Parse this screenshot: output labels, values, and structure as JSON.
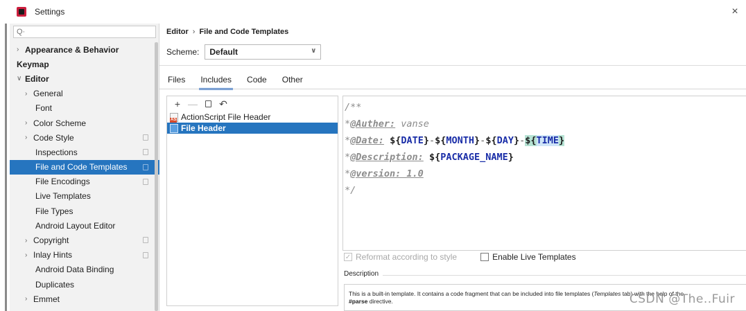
{
  "window": {
    "title": "Settings",
    "close_symbol": "×"
  },
  "search": {
    "placeholder": "Q·"
  },
  "sidebar": {
    "items": [
      {
        "label": "Appearance & Behavior",
        "level": 0,
        "arrow": ">",
        "bold": true,
        "copy": false,
        "selected": false
      },
      {
        "label": "Keymap",
        "level": 0,
        "arrow": "",
        "bold": true,
        "copy": false,
        "selected": false
      },
      {
        "label": "Editor",
        "level": 0,
        "arrow": "v",
        "bold": true,
        "copy": false,
        "selected": false
      },
      {
        "label": "General",
        "level": 1,
        "arrow": ">",
        "bold": false,
        "copy": false,
        "selected": false
      },
      {
        "label": "Font",
        "level": 2,
        "arrow": "",
        "bold": false,
        "copy": false,
        "selected": false
      },
      {
        "label": "Color Scheme",
        "level": 1,
        "arrow": ">",
        "bold": false,
        "copy": false,
        "selected": false
      },
      {
        "label": "Code Style",
        "level": 1,
        "arrow": ">",
        "bold": false,
        "copy": true,
        "selected": false
      },
      {
        "label": "Inspections",
        "level": 2,
        "arrow": "",
        "bold": false,
        "copy": true,
        "selected": false
      },
      {
        "label": "File and Code Templates",
        "level": 2,
        "arrow": "",
        "bold": false,
        "copy": true,
        "selected": true
      },
      {
        "label": "File Encodings",
        "level": 2,
        "arrow": "",
        "bold": false,
        "copy": true,
        "selected": false
      },
      {
        "label": "Live Templates",
        "level": 2,
        "arrow": "",
        "bold": false,
        "copy": false,
        "selected": false
      },
      {
        "label": "File Types",
        "level": 2,
        "arrow": "",
        "bold": false,
        "copy": false,
        "selected": false
      },
      {
        "label": "Android Layout Editor",
        "level": 2,
        "arrow": "",
        "bold": false,
        "copy": false,
        "selected": false
      },
      {
        "label": "Copyright",
        "level": 1,
        "arrow": ">",
        "bold": false,
        "copy": true,
        "selected": false
      },
      {
        "label": "Inlay Hints",
        "level": 1,
        "arrow": ">",
        "bold": false,
        "copy": true,
        "selected": false
      },
      {
        "label": "Android Data Binding",
        "level": 2,
        "arrow": "",
        "bold": false,
        "copy": false,
        "selected": false
      },
      {
        "label": "Duplicates",
        "level": 2,
        "arrow": "",
        "bold": false,
        "copy": false,
        "selected": false
      },
      {
        "label": "Emmet",
        "level": 1,
        "arrow": ">",
        "bold": false,
        "copy": false,
        "selected": false
      }
    ]
  },
  "breadcrumb": {
    "parent": "Editor",
    "separator": "›",
    "current": "File and Code Templates"
  },
  "scheme": {
    "label": "Scheme:",
    "value": "Default"
  },
  "tabs": [
    {
      "label": "Files",
      "active": false
    },
    {
      "label": "Includes",
      "active": true
    },
    {
      "label": "Code",
      "active": false
    },
    {
      "label": "Other",
      "active": false
    }
  ],
  "toolbar": {
    "add": "+",
    "remove": "—",
    "reset": "↶"
  },
  "templates": [
    {
      "name": "ActionScript File Header",
      "icon": "actionscript-file-icon",
      "selected": false
    },
    {
      "name": "File Header",
      "icon": "file-header-icon",
      "selected": true
    }
  ],
  "editor": {
    "line1": "/**",
    "line2_prefix": "*",
    "line2_tag": "@Auther:",
    "line2_value": " vanse",
    "line3_prefix": "*",
    "line3_tag": "@Date:",
    "line3_space": " ",
    "line3_d1": "${",
    "line3_v1": "DATE",
    "line3_d1c": "}",
    "line3_dash1": "-",
    "line3_d2": "${",
    "line3_v2": "MONTH",
    "line3_d2c": "}",
    "line3_dash2": "-",
    "line3_d3": "${",
    "line3_v3": "DAY",
    "line3_d3c": "}",
    "line3_dash3": "-",
    "line3_d4": "${",
    "line3_v4": "TIME",
    "line3_d4c": "}",
    "line4_prefix": "*",
    "line4_tag": "@Description:",
    "line4_space": " ",
    "line4_d": "${",
    "line4_v": "PACKAGE_NAME",
    "line4_dc": "}",
    "line5_prefix": "*",
    "line5_tag": "@version: 1.0",
    "line6": "*/"
  },
  "options": {
    "reformat_label": "Reformat according to style",
    "reformat_checked": true,
    "live_label": "Enable Live Templates",
    "live_checked": false,
    "check_mark": "✓"
  },
  "description": {
    "label": "Description",
    "text_part1": "This is a built-in template. It contains a code fragment that can be included into file templates (",
    "text_italic": "Templates",
    "text_part2": " tab) with the help of the",
    "text_bold": "#parse",
    "text_part3": " directive."
  },
  "watermark": "CSDN @The..Fuir"
}
